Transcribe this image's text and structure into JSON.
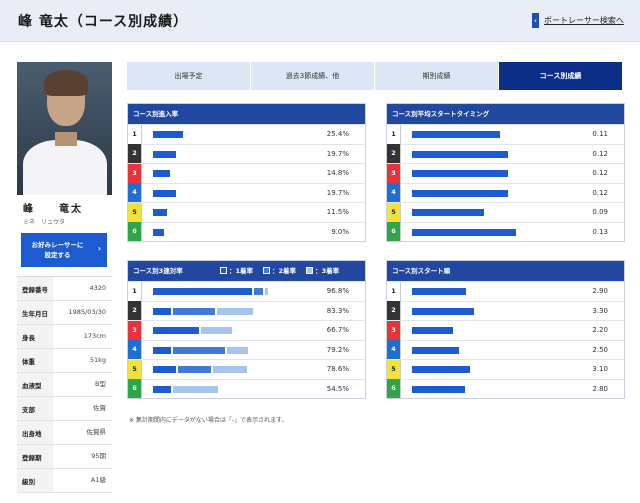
{
  "header": {
    "title": "峰 竜太（コース別成績）",
    "back_label": "ボートレーサー検索へ",
    "back_arrow": "‹"
  },
  "profile": {
    "name": "峰　　竜太",
    "kana": "ミネ　リュウタ",
    "fav_button": "お好みレーサーに\n設定する",
    "fav_chevron": "›",
    "info": [
      {
        "k": "登録番号",
        "v": "4320"
      },
      {
        "k": "生年月日",
        "v": "1985/03/30"
      },
      {
        "k": "身長",
        "v": "173cm"
      },
      {
        "k": "体重",
        "v": "51kg"
      },
      {
        "k": "血液型",
        "v": "B型"
      },
      {
        "k": "支部",
        "v": "佐賀"
      },
      {
        "k": "出身地",
        "v": "佐賀県"
      },
      {
        "k": "登録期",
        "v": "95期"
      },
      {
        "k": "級別",
        "v": "A1級"
      }
    ]
  },
  "tabs": [
    {
      "label": "出場予定",
      "active": false
    },
    {
      "label": "過去3節成績、他",
      "active": false
    },
    {
      "label": "期別成績",
      "active": false
    },
    {
      "label": "コース別成績",
      "active": true
    }
  ],
  "lane_colors": [
    "#ffffff",
    "#333333",
    "#e8333b",
    "#1f6fd1",
    "#f2e33a",
    "#2ea548"
  ],
  "lane_text_colors": [
    "#222222",
    "#ffffff",
    "#ffffff",
    "#ffffff",
    "#222222",
    "#ffffff"
  ],
  "panels": {
    "entry": {
      "title": "コース別進入率",
      "rows": [
        {
          "lane": "1",
          "value": 25.4,
          "label": "25.4%"
        },
        {
          "lane": "2",
          "value": 19.7,
          "label": "19.7%"
        },
        {
          "lane": "3",
          "value": 14.8,
          "label": "14.8%"
        },
        {
          "lane": "4",
          "value": 19.7,
          "label": "19.7%"
        },
        {
          "lane": "5",
          "value": 11.5,
          "label": "11.5%"
        },
        {
          "lane": "6",
          "value": 9.0,
          "label": "9.0%"
        }
      ]
    },
    "timing": {
      "title": "コース別平均スタートタイミング",
      "rows": [
        {
          "lane": "1",
          "value": 0.11,
          "label": "0.11"
        },
        {
          "lane": "2",
          "value": 0.12,
          "label": "0.12"
        },
        {
          "lane": "3",
          "value": 0.12,
          "label": "0.12"
        },
        {
          "lane": "4",
          "value": 0.12,
          "label": "0.12"
        },
        {
          "lane": "5",
          "value": 0.09,
          "label": "0.09"
        },
        {
          "lane": "6",
          "value": 0.13,
          "label": "0.13"
        }
      ]
    },
    "top3": {
      "title": "コース別3連対率",
      "legend": [
        "1着率",
        "2着率",
        "3着率"
      ],
      "legend_markers": [
        "□",
        "□",
        "□"
      ],
      "colors": [
        "#1d5bd0",
        "#3f7ad9",
        "#a6c4ec"
      ],
      "rows": [
        {
          "lane": "1",
          "first": 86,
          "second": 8,
          "third": 2.8,
          "label": "96.8%"
        },
        {
          "lane": "2",
          "first": 16,
          "second": 36,
          "third": 31.3,
          "label": "83.3%"
        },
        {
          "lane": "3",
          "first": 40,
          "second": 0,
          "third": 26.7,
          "label": "66.7%"
        },
        {
          "lane": "4",
          "first": 16,
          "second": 45,
          "third": 18.2,
          "label": "79.2%"
        },
        {
          "lane": "5",
          "first": 20,
          "second": 29,
          "third": 29.6,
          "label": "78.6%"
        },
        {
          "lane": "6",
          "first": 16,
          "second": 0,
          "third": 38.5,
          "label": "54.5%"
        }
      ]
    },
    "startorder": {
      "title": "コース別スタート順",
      "rows": [
        {
          "lane": "1",
          "value": 2.9,
          "label": "2.90"
        },
        {
          "lane": "2",
          "value": 3.3,
          "label": "3.30"
        },
        {
          "lane": "3",
          "value": 2.2,
          "label": "2.20"
        },
        {
          "lane": "4",
          "value": 2.5,
          "label": "2.50"
        },
        {
          "lane": "5",
          "value": 3.1,
          "label": "3.10"
        },
        {
          "lane": "6",
          "value": 2.8,
          "label": "2.80"
        }
      ]
    }
  },
  "note": "※ 集計期間内にデータがない場合は「-」で表示されます。"
}
